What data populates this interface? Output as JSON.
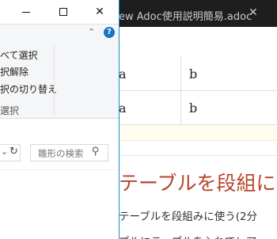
{
  "editor": {
    "tab_title": "ew Adoc使用説明簡易.adoc",
    "tab_close": "✕",
    "table_rows": [
      {
        "c1": "a",
        "c2": "b"
      },
      {
        "c1": "a",
        "c2": "b"
      }
    ],
    "heading": "テーブルを段組に",
    "paragraph": "テーブルを段組みに使う(2分",
    "paragraph2": "ブルにテーブルを入れてレア"
  },
  "explorer": {
    "minimize_label": "—",
    "close_label": "✕",
    "ribbon": {
      "select_all": "べて選択",
      "deselect": "択解除",
      "invert": "択の切り替え",
      "group_label": "選択"
    },
    "search_placeholder": "雛形の検索"
  }
}
